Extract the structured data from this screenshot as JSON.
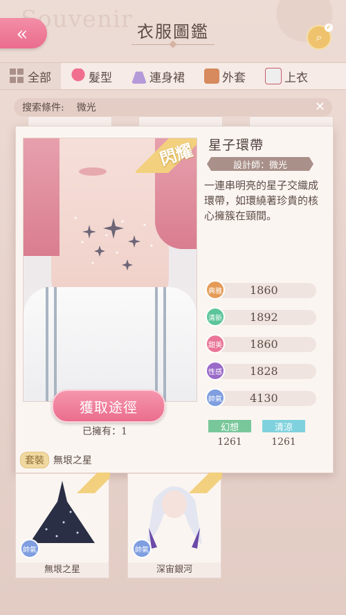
{
  "header": {
    "title": "衣服圖鑑",
    "back_icon": "double-chevron-left-icon",
    "bg_text": "Souvenir"
  },
  "tabs": [
    {
      "label": "全部",
      "icon": "grid-icon",
      "active": true
    },
    {
      "label": "髮型",
      "icon": "hair-icon"
    },
    {
      "label": "連身裙",
      "icon": "dress-icon"
    },
    {
      "label": "外套",
      "icon": "coat-icon"
    },
    {
      "label": "上衣",
      "icon": "top-icon"
    }
  ],
  "filter": {
    "label": "搜索條件:",
    "value": "微光"
  },
  "detail": {
    "badge": "閃耀",
    "name": "星子環帶",
    "designer": "設計師：微光",
    "description": "一連串明亮的星子交織成環帶，如環繞著珍貴的核心擁簇在頸間。",
    "obtain_label": "獲取途徑",
    "owned": "已擁有：1",
    "suit_tag": "套裝",
    "suit_name": "無垠之星",
    "stats": [
      {
        "label": "典雅",
        "value": "1860",
        "color": "#e59b57"
      },
      {
        "label": "清新",
        "value": "1892",
        "color": "#5cc59a"
      },
      {
        "label": "甜美",
        "value": "1860",
        "color": "#ea7596"
      },
      {
        "label": "性感",
        "value": "1828",
        "color": "#9a6ac9"
      },
      {
        "label": "帥氣",
        "value": "4130",
        "color": "#7f9ee0"
      }
    ],
    "tags": [
      {
        "label": "幻想",
        "value": "1261",
        "color": "#78c79a"
      },
      {
        "label": "清涼",
        "value": "1261",
        "color": "#7fd2dd"
      }
    ]
  },
  "cards": [
    {
      "name": "無垠之星",
      "attr": "帥氣"
    },
    {
      "name": "深宙銀河",
      "attr": "帥氣"
    }
  ]
}
